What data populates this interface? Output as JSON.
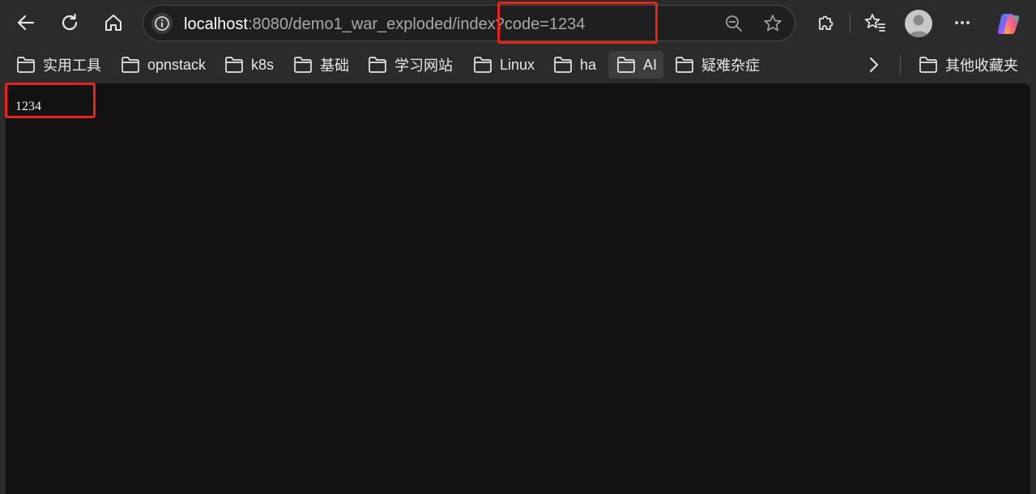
{
  "toolbar": {
    "back": "back-icon",
    "refresh": "refresh-icon",
    "home": "home-icon",
    "address": {
      "host": "localhost",
      "rest": ":8080/demo1_war_exploded/index?code=1234"
    },
    "extensions": "extensions-icon",
    "favorites": "favorites-icon",
    "more": "more-icon"
  },
  "bookmarks": [
    {
      "label": "实用工具"
    },
    {
      "label": "opnstack"
    },
    {
      "label": "k8s"
    },
    {
      "label": "基础"
    },
    {
      "label": "学习网站"
    },
    {
      "label": "Linux"
    },
    {
      "label": "ha"
    },
    {
      "label": "AI"
    },
    {
      "label": "疑难杂症"
    }
  ],
  "other_bookmarks": "其他收藏夹",
  "page": {
    "body_text": "1234"
  },
  "colors": {
    "highlight": "#e8231a",
    "background": "#121212",
    "chrome": "#2b2b2b"
  }
}
